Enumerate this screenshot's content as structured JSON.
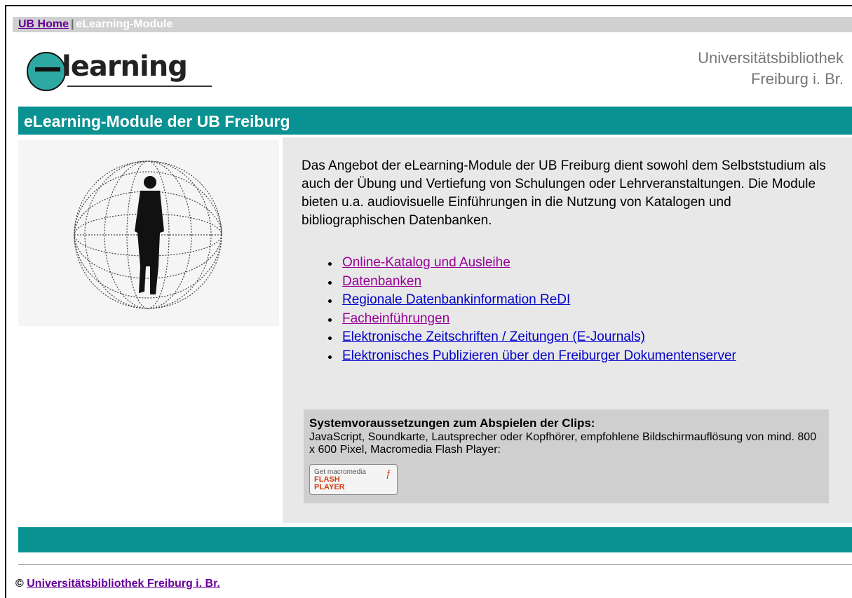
{
  "breadcrumb": {
    "home_link": "UB Home",
    "separator": "|",
    "current": "eLearning-Module"
  },
  "logo": {
    "text": "learning",
    "icon": "e-globe-logo-icon"
  },
  "institution": {
    "line1": "Universitätsbibliothek",
    "line2": "Freiburg i. Br."
  },
  "header": {
    "title": "eLearning-Module der UB Freiburg"
  },
  "main": {
    "image": "binary-globe-person-icon",
    "intro": "Das Angebot der eLearning-Module der UB Freiburg dient sowohl dem Selbststudium als auch der Übung und Vertiefung von Schulungen oder Lehrveranstaltungen. Die Module bieten u.a. audiovisuelle Einführungen in die Nutzung von Katalogen und bibliographischen Datenbanken.",
    "links": [
      {
        "label": "Online-Katalog und Ausleihe",
        "visited": true
      },
      {
        "label": "Datenbanken",
        "visited": true
      },
      {
        "label": "Regionale Datenbankinformation ReDI",
        "visited": false
      },
      {
        "label": "Facheinführungen",
        "visited": true
      },
      {
        "label": "Elektronische Zeitschriften / Zeitungen (E-Journals)",
        "visited": false
      },
      {
        "label": "Elektronisches Publizieren über den Freiburger Dokumentenserver",
        "visited": false
      }
    ],
    "requirements": {
      "title": "Systemvoraussetzungen zum Abspielen der Clips:",
      "text": "JavaScript, Soundkarte, Lautsprecher oder Kopfhörer, empfohlene Bildschirmauflösung von mind. 800 x 600 Pixel, Macromedia Flash Player:",
      "button_line1": "Get macromedia",
      "button_line2": "FLASH",
      "button_line3": "PLAYER"
    }
  },
  "footer": {
    "copyright": "©",
    "link": "Universitätsbibliothek Freiburg i. Br."
  },
  "colors": {
    "teal": "#0a9191",
    "visited_link": "#990099",
    "link": "#0000cc"
  }
}
